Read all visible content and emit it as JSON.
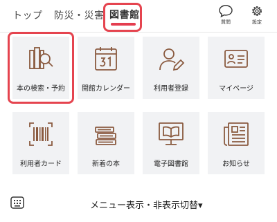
{
  "tabs": [
    {
      "label": "トップ"
    },
    {
      "label": "防災・災害"
    },
    {
      "label": "図書館"
    }
  ],
  "header_icons": {
    "question": "質問",
    "settings": "設定"
  },
  "tiles": [
    {
      "label": "本の検索・予約",
      "icon": "book-search-icon"
    },
    {
      "label": "開館カレンダー",
      "icon": "calendar-icon"
    },
    {
      "label": "利用者登録",
      "icon": "user-edit-icon"
    },
    {
      "label": "マイページ",
      "icon": "id-card-icon"
    },
    {
      "label": "利用者カード",
      "icon": "barcode-icon"
    },
    {
      "label": "新着の本",
      "icon": "book-stack-icon"
    },
    {
      "label": "電子図書館",
      "icon": "e-library-icon"
    },
    {
      "label": "お知らせ",
      "icon": "notice-icon"
    }
  ],
  "menu_toggle": {
    "label": "メニュー表示・非表示切替▾"
  },
  "colors": {
    "accent": "#e43d4f",
    "icon": "#8a5a3f",
    "tile_bg": "#f1f2f4"
  }
}
